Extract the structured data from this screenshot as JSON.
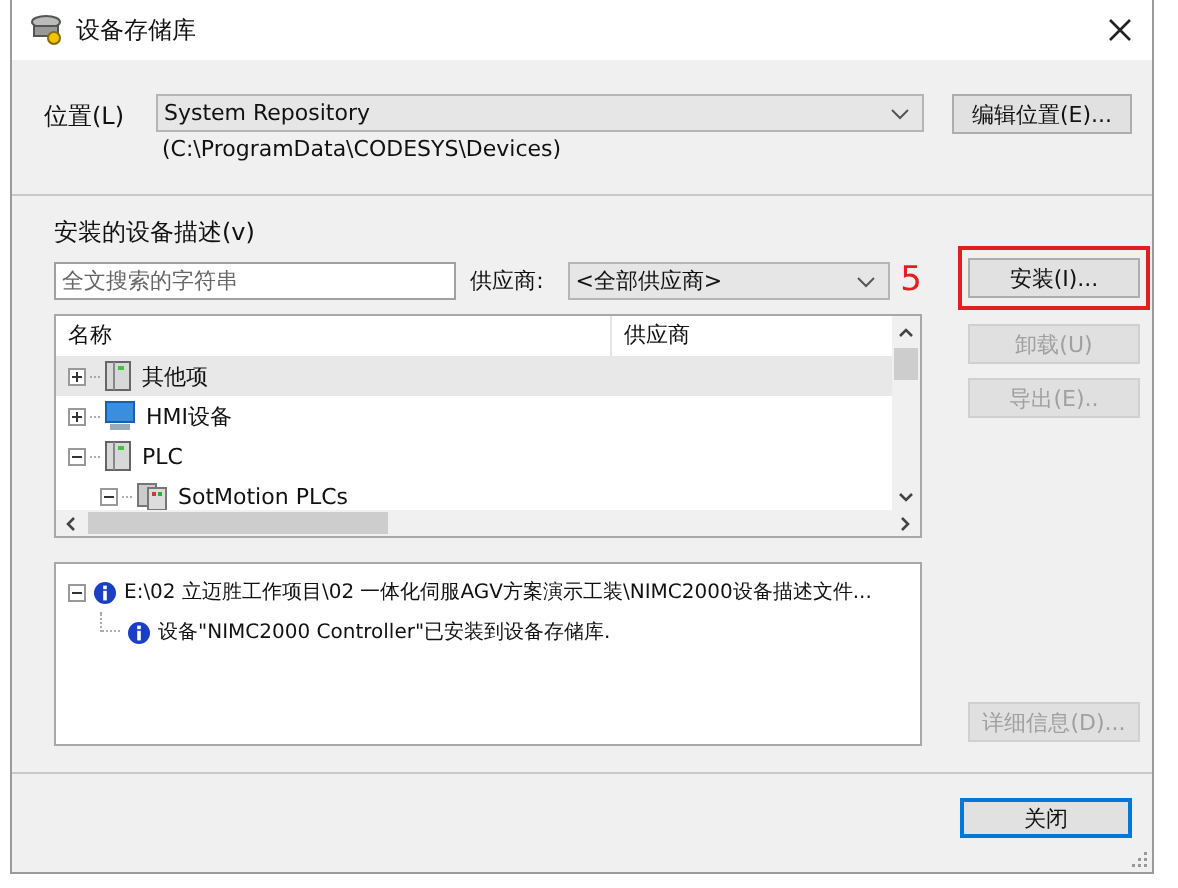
{
  "window": {
    "title": "设备存储库"
  },
  "location": {
    "label": "位置(L)",
    "value": "System Repository",
    "path": "(C:\\ProgramData\\CODESYS\\Devices)"
  },
  "edit_location_button": {
    "label": "编辑位置(E)..."
  },
  "installed": {
    "label": "安装的设备描述(v)"
  },
  "search": {
    "placeholder": "全文搜索的字符串"
  },
  "vendor": {
    "label": "供应商:",
    "value": "<全部供应商>"
  },
  "step_marker": "5",
  "side_buttons": [
    {
      "label": "安装(I)...",
      "disabled": false,
      "highlighted": true
    },
    {
      "label": "卸载(U)",
      "disabled": true,
      "highlighted": false
    },
    {
      "label": "导出(E)..",
      "disabled": true,
      "highlighted": false
    }
  ],
  "tree": {
    "columns": [
      "名称",
      "供应商"
    ],
    "items": [
      {
        "kind": "cabinet",
        "name": "其他项",
        "expanded": false,
        "selected": true
      },
      {
        "kind": "monitor",
        "name": "HMI设备",
        "expanded": false,
        "selected": false
      },
      {
        "kind": "cabinet",
        "name": "PLC",
        "expanded": true,
        "selected": false,
        "children": [
          {
            "kind": "rack",
            "name": "SotMotion PLCs",
            "expanded": true,
            "selected": false
          }
        ]
      }
    ]
  },
  "messages": [
    {
      "kind": "info",
      "text": "E:\\02 立迈胜工作项目\\02 一体化伺服AGV方案演示工装\\NIMC2000设备描述文件...",
      "expanded": true,
      "children": [
        {
          "kind": "info",
          "text": "设备\"NIMC2000 Controller\"已安装到设备存储库."
        }
      ]
    }
  ],
  "details_button": {
    "label": "详细信息(D)...",
    "disabled": true
  },
  "close_button": {
    "label": "关闭",
    "focused": true
  }
}
